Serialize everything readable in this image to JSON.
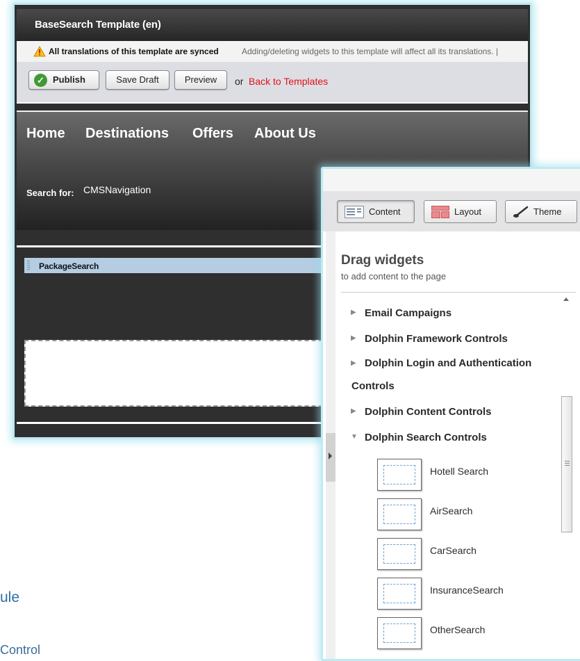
{
  "background": {
    "fragment_1": "ule",
    "fragment_2": "Control"
  },
  "editor": {
    "title": "BaseSearch Template (en)",
    "sync_notice_strong": "All translations of this template are synced",
    "sync_notice_rest": "Adding/deleting widgets to this template will affect all its translations. |",
    "actions": {
      "publish": "Publish",
      "save_draft": "Save Draft",
      "preview": "Preview",
      "or": "or",
      "back": "Back to Templates"
    },
    "nav": [
      "Home",
      "Destinations",
      "Offers",
      "About Us"
    ],
    "search_for": "Search for:",
    "search_widget": "CMSNavigation",
    "zone_widget": "PackageSearch"
  },
  "panel": {
    "tabs": {
      "content": "Content",
      "layout": "Layout",
      "theme": "Theme"
    },
    "active_tab": "Content",
    "heading": "Drag widgets",
    "subheading": "to add content to the page",
    "categories": [
      {
        "label": "Email Campaigns",
        "expanded": false
      },
      {
        "label": "Dolphin Framework Controls",
        "expanded": false
      },
      {
        "label_line1": "Dolphin Login and Authentication",
        "label_line2": "Controls",
        "expanded": false
      },
      {
        "label": "Dolphin Content Controls",
        "expanded": false
      },
      {
        "label": "Dolphin Search Controls",
        "expanded": true
      }
    ],
    "widgets": [
      "Hotell Search",
      "AirSearch",
      "CarSearch",
      "InsuranceSearch",
      "OtherSearch"
    ],
    "icons": {
      "collapsed": "triangle-right-icon",
      "expanded": "triangle-down-icon",
      "publish": "check-circle-icon",
      "warning": "warning-triangle-icon",
      "content_tab": "content-list-icon",
      "layout_tab": "layout-grid-icon",
      "theme_tab": "paintbrush-icon"
    },
    "colors": {
      "link_red": "#e0111a",
      "publish_green": "#3f9a35",
      "panel_glow": "#bfeaf2",
      "widget_bar": "#b4cde3"
    }
  }
}
